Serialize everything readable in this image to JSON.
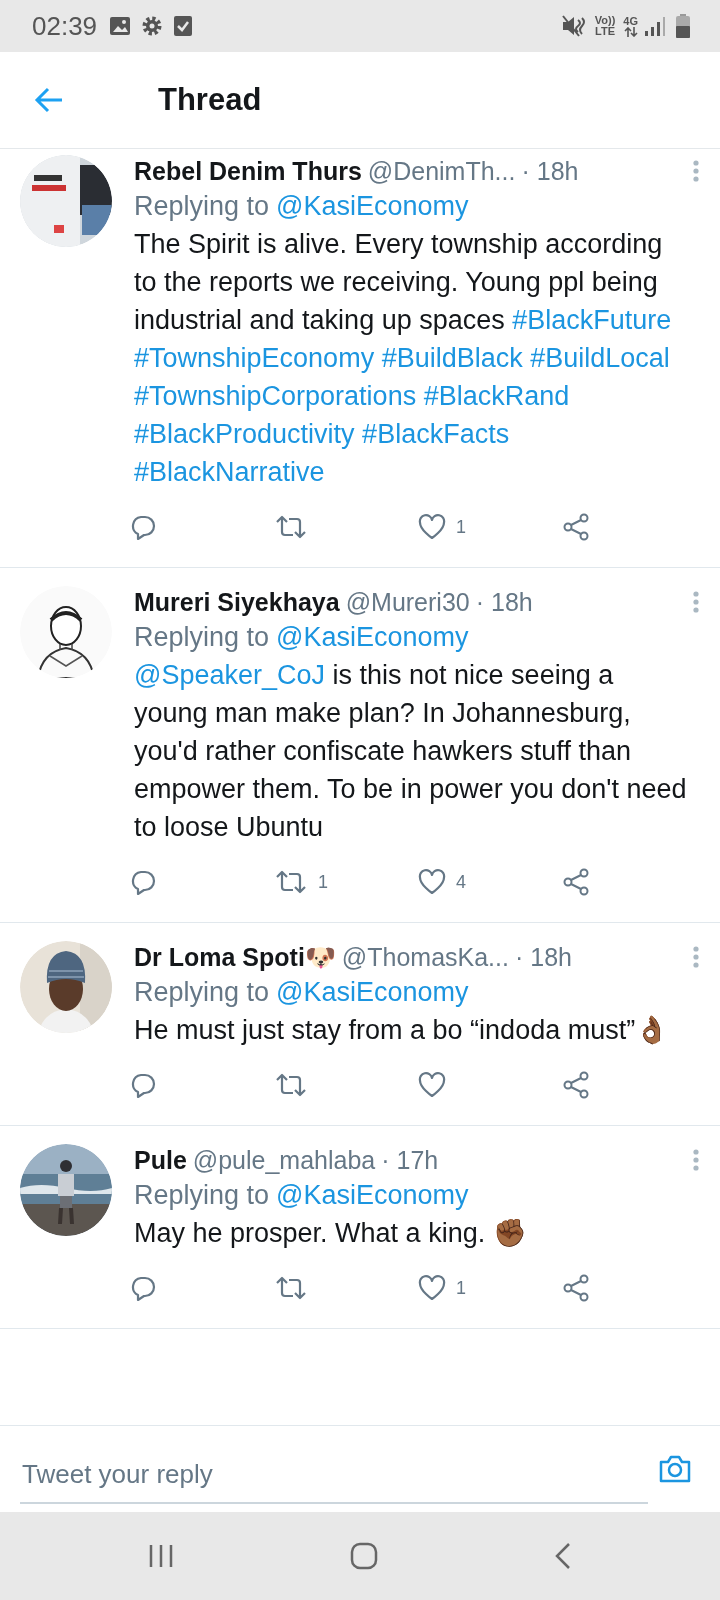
{
  "status_bar": {
    "time": "02:39",
    "volte_top": "Vo))",
    "volte_bottom": "LTE",
    "network": "4G"
  },
  "app_bar": {
    "title": "Thread"
  },
  "tweets": [
    {
      "avatar": {
        "kind": "picture"
      },
      "name": "Rebel Denim Thurs",
      "handle": "@DenimTh...",
      "time": "· 18h",
      "replying_prefix": "Replying to",
      "replying_handle": "@KasiEconomy",
      "body": [
        {
          "kind": "text",
          "text": "The Spirit is alive. Every township according to the reports we receiving. Young ppl being industrial and taking up spaces"
        },
        {
          "kind": "link",
          "text": "#BlackFuture"
        },
        {
          "kind": "link",
          "text": "#TownshipEconomy"
        },
        {
          "kind": "link",
          "text": "#BuildBlack"
        },
        {
          "kind": "link",
          "text": "#BuildLocal"
        },
        {
          "kind": "link",
          "text": "#TownshipCorporations"
        },
        {
          "kind": "link",
          "text": "#BlackRand"
        },
        {
          "kind": "link",
          "text": "#BlackProductivity"
        },
        {
          "kind": "link",
          "text": "#BlackFacts"
        },
        {
          "kind": "link",
          "text": "#BlackNarrative"
        }
      ],
      "likes": "1"
    },
    {
      "avatar": {
        "kind": "picture"
      },
      "name": "Mureri Siyekhaya",
      "handle": "@Mureri30",
      "time": "· 18h",
      "replying_prefix": "Replying to",
      "replying_handle": "@KasiEconomy",
      "body": [
        {
          "kind": "link",
          "text": "@Speaker_CoJ"
        },
        {
          "kind": "text",
          "text": "is this not nice seeing a young man make plan? In Johannesburg, you'd rather confiscate hawkers stuff than empower them. To be in power you don't need to loose Ubuntu"
        }
      ],
      "retweets": "1",
      "likes": "4"
    },
    {
      "avatar": {
        "kind": "picture"
      },
      "name": "Dr Loma Spoti🐶",
      "handle": "@ThomasKa...",
      "time": "· 18h",
      "replying_prefix": "Replying to",
      "replying_handle": "@KasiEconomy",
      "body": [
        {
          "kind": "text",
          "text": "He must just stay from a bo “indoda must”👌🏾"
        }
      ]
    },
    {
      "avatar": {
        "kind": "picture"
      },
      "name": "Pule",
      "handle": "@pule_mahlaba",
      "time": "· 17h",
      "replying_prefix": "Replying to",
      "replying_handle": "@KasiEconomy",
      "body": [
        {
          "kind": "text",
          "text": "May he prosper. What a king. ✊🏾"
        }
      ],
      "likes": "1"
    }
  ],
  "reply_bar": {
    "placeholder": "Tweet your reply"
  }
}
